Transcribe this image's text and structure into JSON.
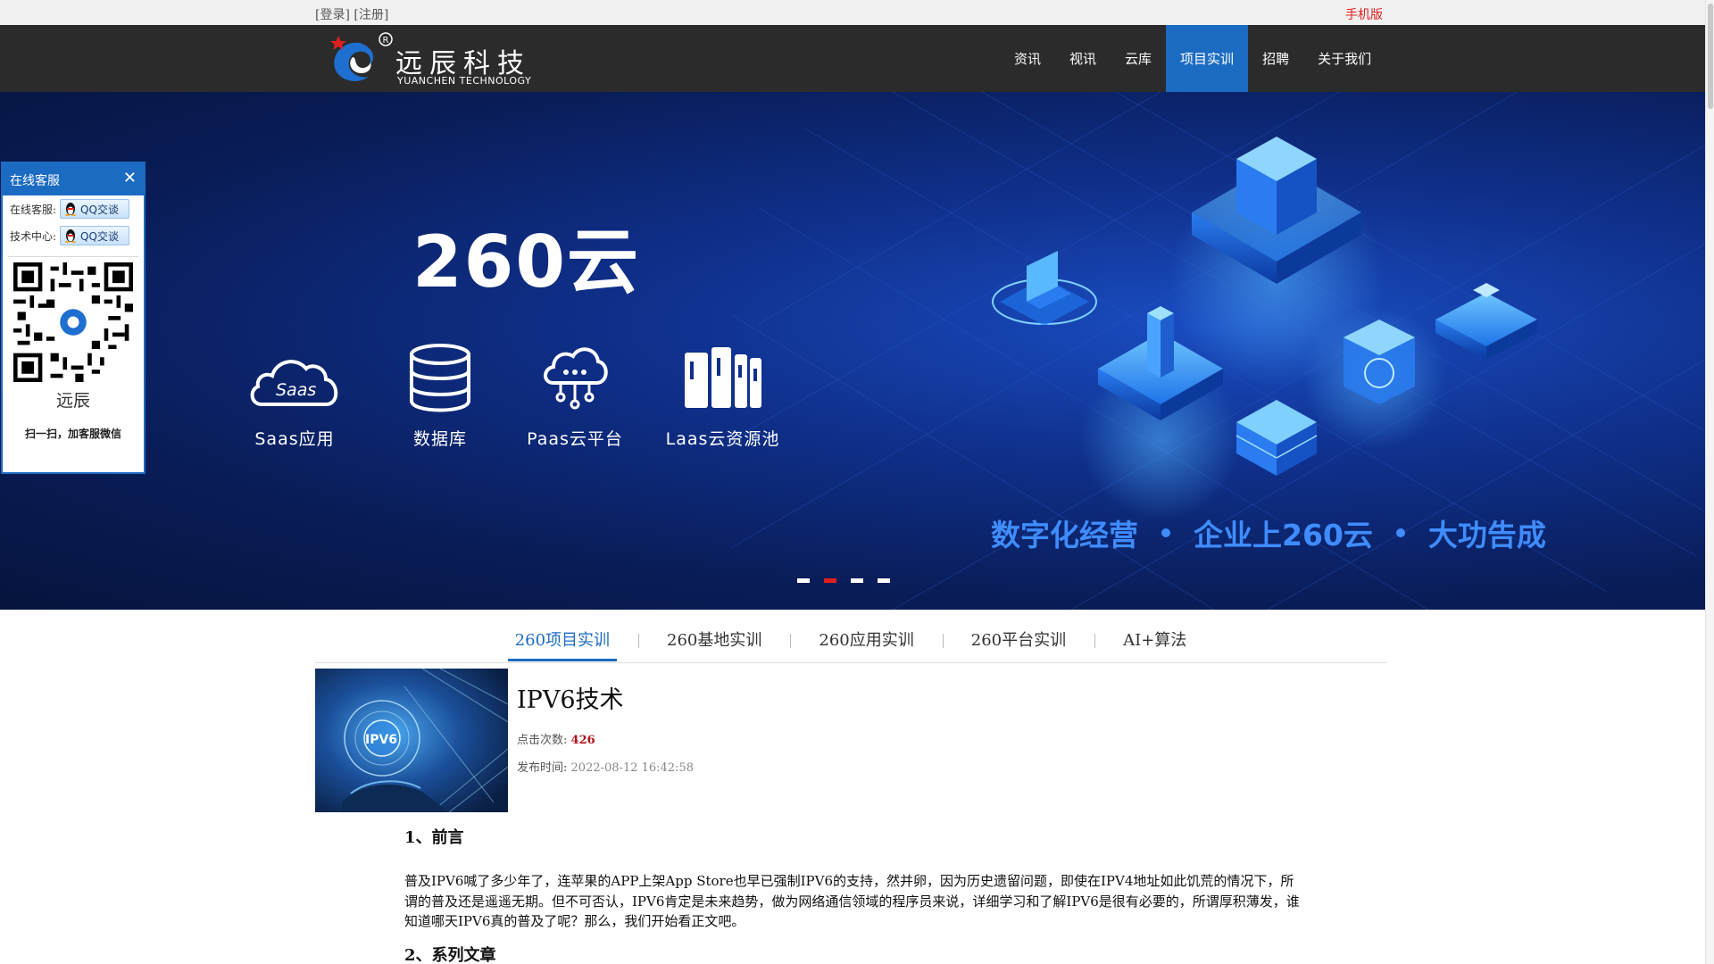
{
  "topbar": {
    "login": "[登录]",
    "register": "[注册]",
    "mobile": "手机版"
  },
  "header": {
    "logo_cn": "远辰科技",
    "logo_en": "YUANCHEN TECHNOLOGY",
    "nav": [
      "资讯",
      "视讯",
      "云库",
      "项目实训",
      "招聘",
      "关于我们"
    ],
    "active_nav": "项目实训"
  },
  "banner": {
    "title": "260云",
    "services": [
      {
        "label": "Saas应用",
        "icon": "cloud-saas-icon",
        "icon_text": "Saas"
      },
      {
        "label": "数据库",
        "icon": "database-icon"
      },
      {
        "label": "Paas云平台",
        "icon": "cloud-network-icon"
      },
      {
        "label": "Laas云资源池",
        "icon": "server-rack-icon"
      }
    ],
    "slogan": [
      "数字化经营",
      "企业上260云",
      "大功告成"
    ],
    "slides": 4,
    "active_slide": 2
  },
  "service_panel": {
    "title": "在线客服",
    "rows": [
      {
        "label": "在线客服:",
        "button": "QQ交谈"
      },
      {
        "label": "技术中心:",
        "button": "QQ交谈"
      }
    ],
    "name": "远辰",
    "tip": "扫一扫，加客服微信"
  },
  "tabs": [
    "260项目实训",
    "260基地实训",
    "260应用实训",
    "260平台实训",
    "AI+算法"
  ],
  "active_tab": "260项目实训",
  "article": {
    "title": "IPV6技术",
    "image_text": "IPV6",
    "hits_label": "点击次数:",
    "hits": "426",
    "time_label": "发布时间:",
    "time": "2022-08-12 16:42:58",
    "section1": "1、前言",
    "paragraph": "普及IPV6喊了多少年了，连苹果的APP上架App Store也早已强制IPV6的支持，然并卵，因为历史遗留问题，即使在IPV4地址如此饥荒的情况下，所谓的普及还是遥遥无期。但不可否认，IPV6肯定是未来趋势，做为网络通信领域的程序员来说，详细学习和了解IPV6是很有必要的，所谓厚积薄发，谁知道哪天IPV6真的普及了呢？那么，我们开始看正文吧。",
    "section2": "2、系列文章"
  },
  "colors": {
    "accent": "#1c6bc2",
    "header_bg": "#2b2b2b",
    "highlight": "#e0201f",
    "slogan": "#3f8cff"
  }
}
